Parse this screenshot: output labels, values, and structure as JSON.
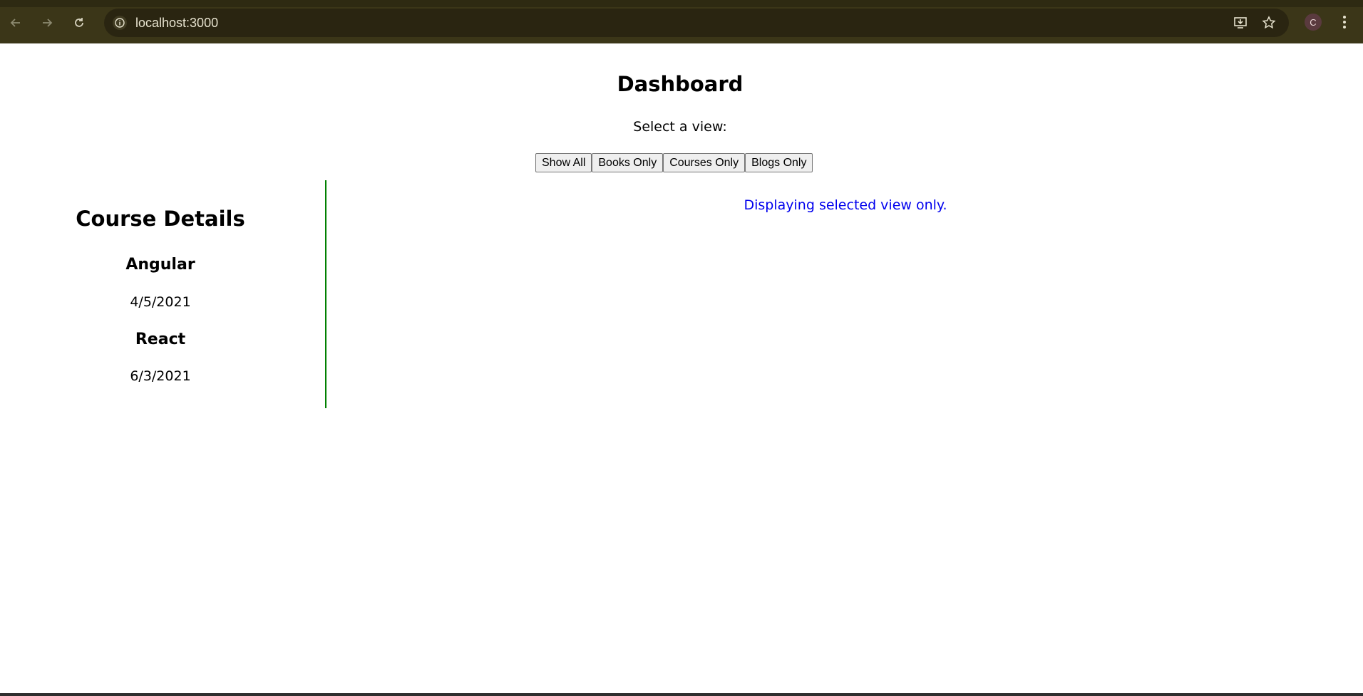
{
  "browser": {
    "url": "localhost:3000",
    "profile_initial": "C",
    "icons": [
      "back-icon",
      "forward-icon",
      "reload-icon",
      "site-info-icon",
      "install-app-icon",
      "bookmark-star-icon",
      "menu-kebab-icon"
    ],
    "theme_color": "#3b3618"
  },
  "page": {
    "title": "Dashboard",
    "select_label": "Select a view:",
    "buttons": {
      "show_all": "Show All",
      "books_only": "Books Only",
      "courses_only": "Courses Only",
      "blogs_only": "Blogs Only"
    },
    "status_message": "Displaying selected view only.",
    "status_color": "#0000ee",
    "divider_color": "#008000"
  },
  "course_details": {
    "title": "Course Details",
    "courses": [
      {
        "name": "Angular",
        "date": "4/5/2021"
      },
      {
        "name": "React",
        "date": "6/3/2021"
      }
    ]
  }
}
